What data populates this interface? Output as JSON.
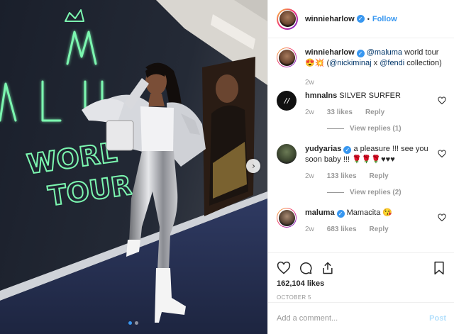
{
  "header": {
    "username": "winnieharlow",
    "separator": "•",
    "follow_label": "Follow"
  },
  "caption": {
    "username": "winnieharlow",
    "mention_1": "@maluma",
    "text_1": " world tour 😍💥 (",
    "mention_2": "@nickiminaj",
    "text_2": " x ",
    "mention_3": "@fendi",
    "text_3": " collection)",
    "time": "2w"
  },
  "comments": [
    {
      "username": "hmnalns",
      "text": "SILVER SURFER",
      "time": "2w",
      "likes": "33 likes",
      "reply": "Reply",
      "view_replies": "View replies (1)"
    },
    {
      "username": "yudyarias",
      "text": "a pleasure !!! see you soon baby !!! 🌹🌹🌹♥♥♥",
      "time": "2w",
      "likes": "133 likes",
      "reply": "Reply",
      "view_replies": "View replies (2)"
    },
    {
      "username": "maluma",
      "text": "Mamacita 😘",
      "time": "2w",
      "likes": "683 likes",
      "reply": "Reply"
    }
  ],
  "stats": {
    "likes": "162,104 likes",
    "date": "OCTOBER 5"
  },
  "composer": {
    "placeholder": "Add a comment...",
    "post_label": "Post"
  },
  "media": {
    "sign_text_1": "A L U",
    "sign_text_2": "WORL",
    "sign_text_3": "TOUR",
    "sign_color": "#7cf7b0",
    "current_slide": 1,
    "total_slides": 2
  },
  "icons": {
    "like": "heart-icon",
    "comment": "comment-icon",
    "share": "share-icon",
    "save": "bookmark-icon",
    "next": "chevron-right-icon"
  },
  "colors": {
    "link": "#3897f0",
    "mention": "#003569",
    "muted": "#999999"
  }
}
